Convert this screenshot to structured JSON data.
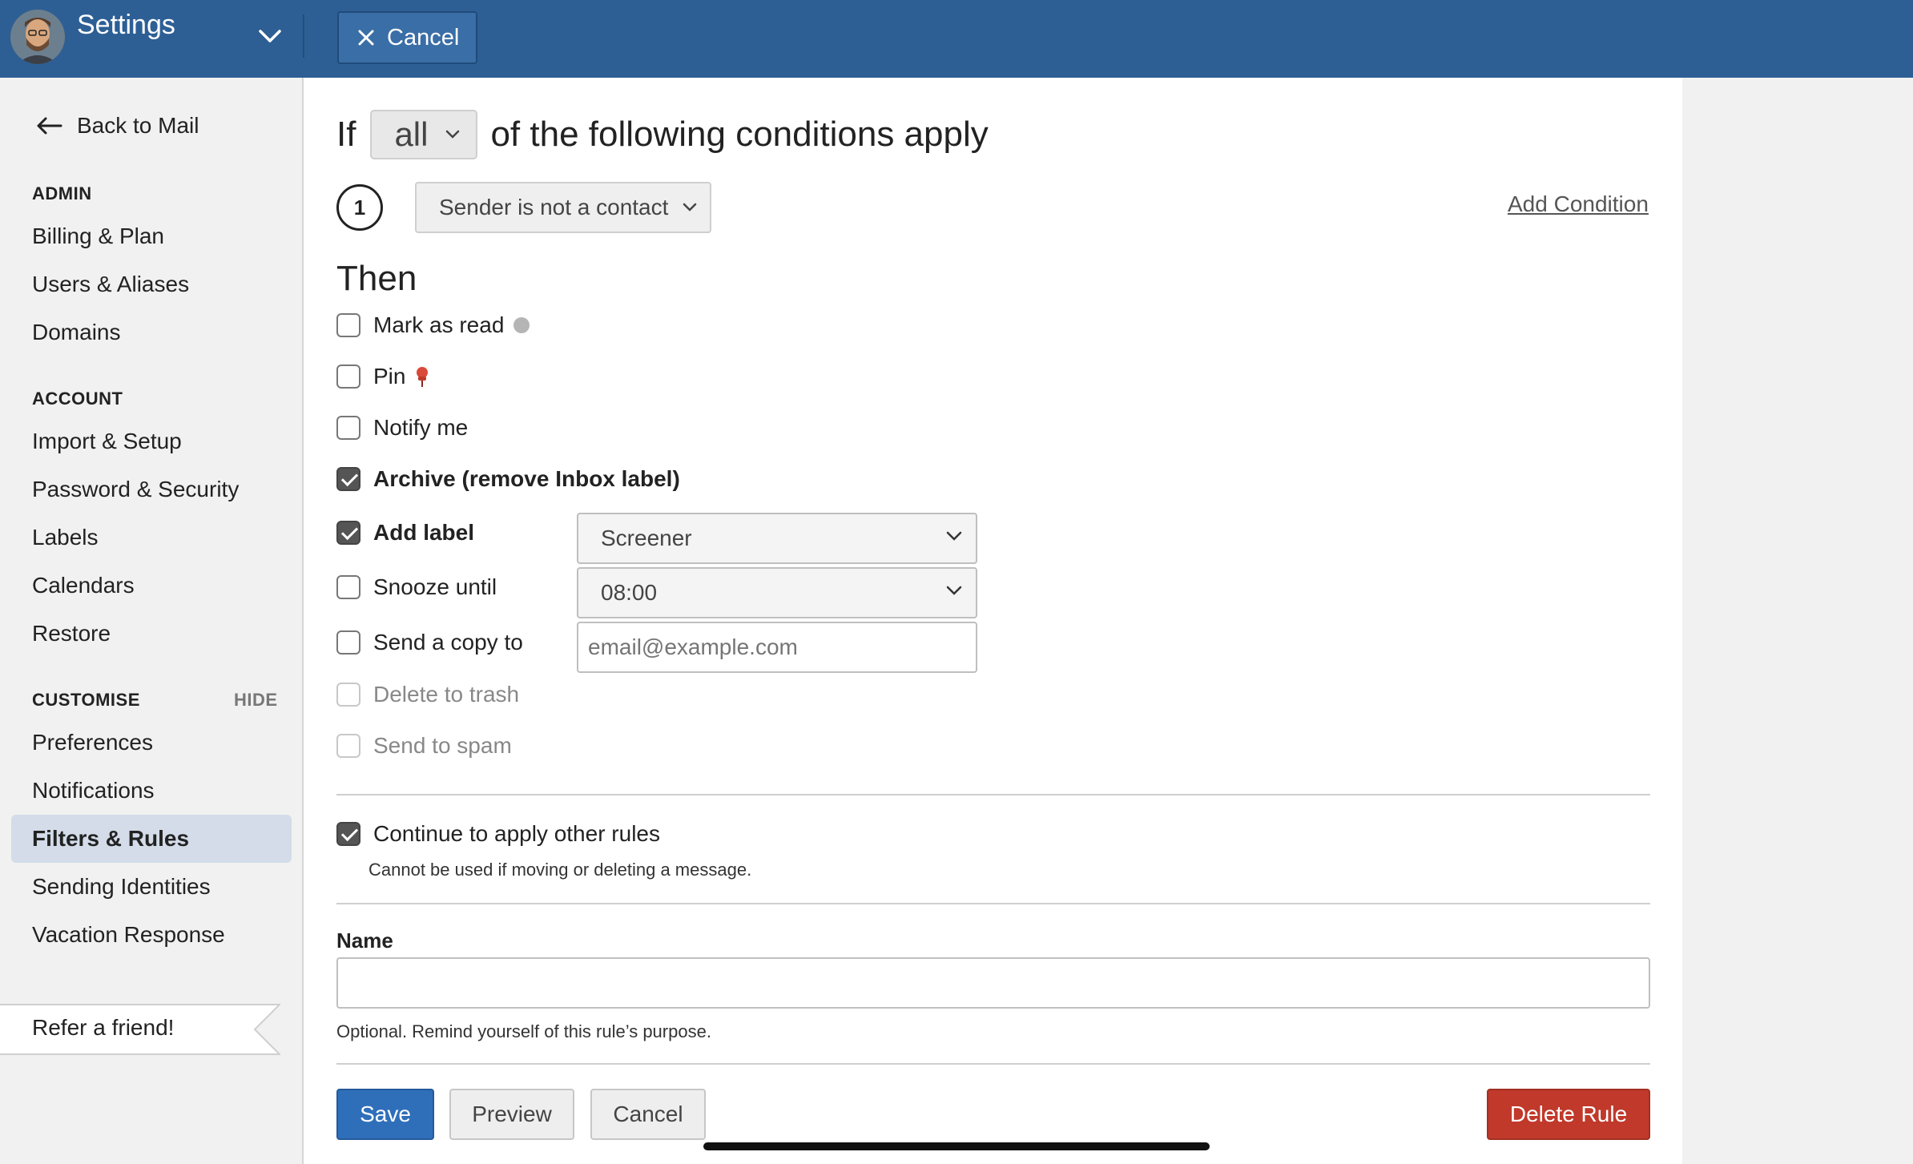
{
  "header": {
    "title": "Settings",
    "cancel_label": "Cancel"
  },
  "sidebar": {
    "back_label": "Back to Mail",
    "sections": {
      "admin": "ADMIN",
      "account": "ACCOUNT",
      "customise": "CUSTOMISE",
      "hide": "HIDE"
    },
    "items": {
      "billing": "Billing & Plan",
      "users": "Users & Aliases",
      "domains": "Domains",
      "import": "Import & Setup",
      "password": "Password & Security",
      "labels": "Labels",
      "calendars": "Calendars",
      "restore": "Restore",
      "preferences": "Preferences",
      "notifications": "Notifications",
      "filters": "Filters & Rules",
      "identities": "Sending Identities",
      "vacation": "Vacation Response"
    },
    "refer_label": "Refer a friend!"
  },
  "rule": {
    "if_prefix": "If",
    "match_value": "all",
    "if_suffix": "of the following conditions apply",
    "condition_number": "1",
    "condition_value": "Sender is not a contact",
    "add_condition": "Add Condition",
    "then_heading": "Then",
    "actions": {
      "mark_read": "Mark as read",
      "pin": "Pin",
      "notify": "Notify me",
      "archive": "Archive (remove Inbox label)",
      "add_label": "Add label",
      "snooze": "Snooze until",
      "send_copy": "Send a copy to",
      "delete": "Delete to trash",
      "spam": "Send to spam"
    },
    "label_value": "Screener",
    "snooze_value": "08:00",
    "copy_placeholder": "email@example.com",
    "continue_label": "Continue to apply other rules",
    "continue_hint": "Cannot be used if moving or deleting a message.",
    "name_label": "Name",
    "name_value": "",
    "name_hint": "Optional. Remind yourself of this rule’s purpose."
  },
  "footer": {
    "save": "Save",
    "preview": "Preview",
    "cancel": "Cancel",
    "delete": "Delete Rule"
  },
  "colors": {
    "header": "#2d5f95",
    "primary": "#2f6fba",
    "danger": "#c0392b",
    "active_nav": "#d3dce8"
  }
}
